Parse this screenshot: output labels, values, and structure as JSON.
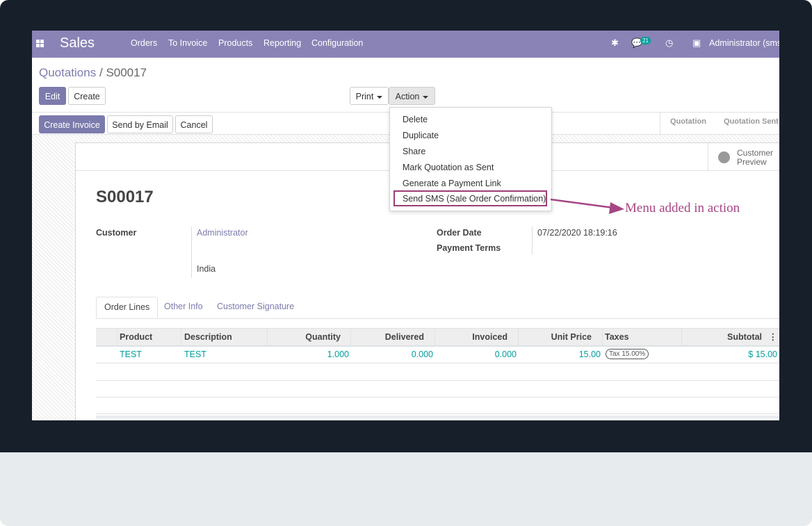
{
  "navbar": {
    "brand": "Sales",
    "menu": [
      "Orders",
      "To Invoice",
      "Products",
      "Reporting",
      "Configuration"
    ],
    "chat_count": "21",
    "user": "Administrator (sms_"
  },
  "breadcrumb": {
    "parent": "Quotations",
    "separator": "/",
    "current": "S00017"
  },
  "buttons": {
    "edit": "Edit",
    "create": "Create",
    "print": "Print",
    "action": "Action",
    "create_invoice": "Create Invoice",
    "send_email": "Send by Email",
    "cancel": "Cancel"
  },
  "status_stages": [
    "Quotation",
    "Quotation Sent"
  ],
  "action_menu": [
    "Delete",
    "Duplicate",
    "Share",
    "Mark Quotation as Sent",
    "Generate a Payment Link",
    "Send SMS (Sale Order Confirmation)"
  ],
  "annotation": "Menu added in action",
  "preview": {
    "line1": "Customer",
    "line2": "Preview"
  },
  "record": {
    "name": "S00017",
    "customer_label": "Customer",
    "customer_name": "Administrator",
    "customer_country": "India",
    "order_date_label": "Order Date",
    "order_date": "07/22/2020 18:19:16",
    "payment_terms_label": "Payment Terms"
  },
  "tabs": [
    "Order Lines",
    "Other Info",
    "Customer Signature"
  ],
  "table": {
    "headers": [
      "Product",
      "Description",
      "Quantity",
      "Delivered",
      "Invoiced",
      "Unit Price",
      "Taxes",
      "Subtotal"
    ],
    "rows": [
      {
        "product": "TEST",
        "description": "TEST",
        "quantity": "1.000",
        "delivered": "0.000",
        "invoiced": "0.000",
        "unit_price": "15.00",
        "taxes": "Tax 15.00%",
        "subtotal": "$ 15.00"
      }
    ]
  },
  "colors": {
    "brand": "#8a83b6",
    "link": "#7c7bad",
    "teal": "#00a09d",
    "annotation": "#a64585"
  }
}
